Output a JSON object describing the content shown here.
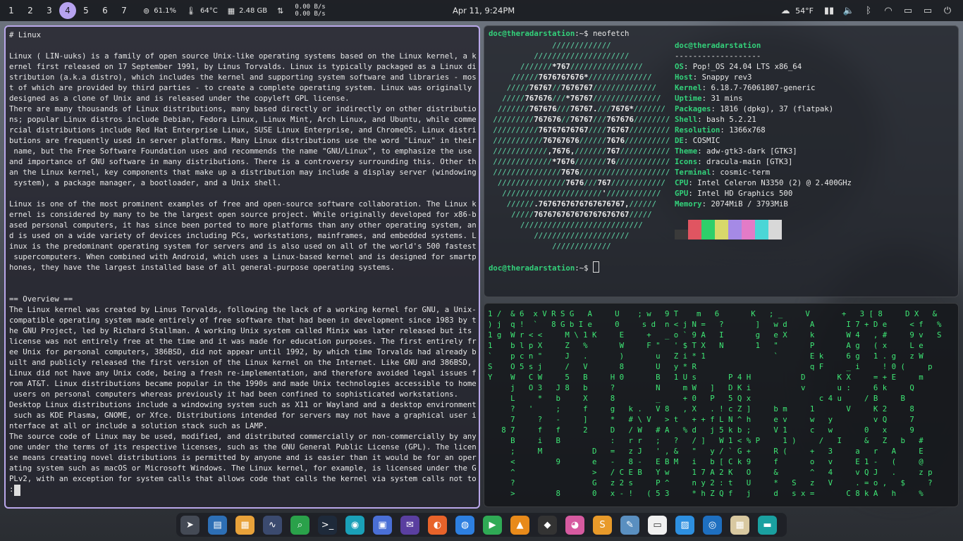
{
  "topbar": {
    "workspaces": [
      "1",
      "2",
      "3",
      "4",
      "5",
      "6",
      "7"
    ],
    "active_workspace": "4",
    "cpu": "61.1%",
    "temp": "64°C",
    "memory": "2.48 GB",
    "net_up": "0.00 B/s",
    "net_down": "0.00 B/s",
    "clock": "Apr 11, 9:24PM",
    "weather": "54°F"
  },
  "left_terminal": {
    "content": "# Linux\n\nLinux ( LIN-uuks) is a family of open source Unix-like operating systems based on the Linux kernel, a k\nernel first released on 17 September 1991, by Linus Torvalds. Linux is typically packaged as a Linux di\nstribution (a.k.a distro), which includes the kernel and supporting system software and libraries - mos\nt of which are provided by third parties - to create a complete operating system. Linux was originally\ndesigned as a clone of Unix and is released under the copyleft GPL license.\nThere are many thousands of Linux distributions, many based directly or indirectly on other distributio\nns; popular Linux distros include Debian, Fedora Linux, Linux Mint, Arch Linux, and Ubuntu, while comme\nrcial distributions include Red Hat Enterprise Linux, SUSE Linux Enterprise, and ChromeOS. Linux distri\nbutions are frequently used in server platforms. Many Linux distributions use the word \"Linux\" in their\n name, but the Free Software Foundation uses and recommends the name \"GNU/Linux\", to emphasize the use\nand importance of GNU software in many distributions. There is a controversy surrounding this. Other th\nan the Linux kernel, key components that make up a distribution may include a display server (windowing\n system), a package manager, a bootloader, and a Unix shell.\n\nLinux is one of the most prominent examples of free and open-source software collaboration. The Linux k\nernel is considered by many to be the largest open source project. While originally developed for x86-b\nased personal computers, it has since been ported to more platforms than any other operating system, an\nd is used on a wide variety of devices including PCs, workstations, mainframes, and embedded systems. L\ninux is the predominant operating system for servers and is also used on all of the world's 500 fastest\n supercomputers. When combined with Android, which uses a Linux-based kernel and is designed for smartp\nhones, they have the largest installed base of all general-purpose operating systems.\n\n\n== Overview ==\nThe Linux kernel was created by Linus Torvalds, following the lack of a working kernel for GNU, a Unix-\ncompatible operating system made entirely of free software that had been in development since 1983 by t\nhe GNU Project, led by Richard Stallman. A working Unix system called Minix was later released but its\nlicense was not entirely free at the time and it was made for education purposes. The first entirely fr\nee Unix for personal computers, 386BSD, did not appear until 1992, by which time Torvalds had already b\nuilt and publicly released the first version of the Linux kernel on the Internet. Like GNU and 386BSD,\nLinux did not have any Unix code, being a fresh re-implementation, and therefore avoided legal issues f\nrom AT&T. Linux distributions became popular in the 1990s and made Unix technologies accessible to home\n users on personal computers whereas previously it had been confined to sophisticated workstations.\nDesktop Linux distributions include a windowing system such as X11 or Wayland and a desktop environment\n such as KDE Plasma, GNOME, or Xfce. Distributions intended for servers may not have a graphical user i\nnterface at all or include a solution stack such as LAMP.\nThe source code of Linux may be used, modified, and distributed commercially or non-commercially by any\none under the terms of its respective licenses, such as the GNU General Public License (GPL). The licen\nse means creating novel distributions is permitted by anyone and is easier than it would be for an oper\nating system such as macOS or Microsoft Windows. The Linux kernel, for example, is licensed under the G\nPLv2, with an exception for system calls that allows code that calls the kernel via system calls not to\n:"
  },
  "neofetch": {
    "prompt_user": "doc@theradarstation",
    "prompt_suffix": ":~$ ",
    "command": "neofetch",
    "logo": [
      "              /////////////",
      "          /////////////////////",
      "       ///////*767////////////////",
      "     //////7676767676*//////////////",
      "    /////76767//7676767//////////////",
      "   /////767676///*76767///////////////",
      "  ///////767676///76767.///7676*///////",
      " /////////767676//76767///767676////////",
      " //////////76767676767////76767/////////",
      " ///////////76767676//////7676//////////",
      " ////////////,7676,///////767///////////",
      " /////////////*7676///////76////////////",
      " ///////////////7676////////////////////",
      "  ///////////////7676///767////////////",
      "   //////////////////////'////////////",
      "    //////.7676767676767676767,//////",
      "     /////767676767676767676767/////",
      "       ///////////////////////////",
      "          /////////////////////",
      "              /////////////"
    ],
    "title": "doc@theradarstation",
    "separator": "-------------------",
    "info": [
      {
        "k": "OS",
        "v": "Pop!_OS 24.04 LTS x86_64"
      },
      {
        "k": "Host",
        "v": "Snappy rev3"
      },
      {
        "k": "Kernel",
        "v": "6.18.7-76061807-generic"
      },
      {
        "k": "Uptime",
        "v": "31 mins"
      },
      {
        "k": "Packages",
        "v": "1816 (dpkg), 37 (flatpak)"
      },
      {
        "k": "Shell",
        "v": "bash 5.2.21"
      },
      {
        "k": "Resolution",
        "v": "1366x768"
      },
      {
        "k": "DE",
        "v": "COSMIC"
      },
      {
        "k": "Theme",
        "v": "adw-gtk3-dark [GTK3]"
      },
      {
        "k": "Icons",
        "v": "dracula-main [GTK3]"
      },
      {
        "k": "Terminal",
        "v": "cosmic-term"
      },
      {
        "k": "CPU",
        "v": "Intel Celeron N3350 (2) @ 2.400GHz"
      },
      {
        "k": "GPU",
        "v": "Intel HD Graphics 500"
      },
      {
        "k": "Memory",
        "v": "2074MiB / 3793MiB"
      }
    ],
    "swatches": [
      "#3a3a3a",
      "#e05561",
      "#2fcf6a",
      "#d8d86a",
      "#a58ae6",
      "#e37bc7",
      "#4ad6d6",
      "#d8d8d8"
    ]
  },
  "matrix": {
    "content": "1 /  & 6  x V R S G   A     U    ; w   9 T    m   6       K   ; _     V       +   3 [ 8     D X   &\n) j  q !  `   8 G b I e     0     s d  n < j N =   ?       ]   w d     A       I 7 + D e     < f   %\n1 g  W r < <     M \\ 1 K     E     +   _ o ` 9 A   I       g   e X     k       W 4   , #     9 v   S\n1    b l p X     Z   %       W     F \"   ' $ T X   N       1   \"       P       A g   ( x     L e\n`    p c n \"     J   .       )       u   Z i * 1               `       E k     6 g   1 . g   z W\nS    O 5 s j     /   V       8       U   y * R                         q F     _ i     ! 0 (     p\nY    W   C W     5   B     H 0       B   1 U s       P 4 H           D       K X     = + E     m\n     j   O 3   J 8   b     ?         N     m W   ]   D K i           v       u :     6 k     Q\n     L     *   b     X     8         _     + 0   P   5 Q x               c 4 u     / B     B\n     ?   '     ;     f     g   k .   V 8   , X   . ! c Z ]     b m     1       V     K 2     8\n     7     ?   -     ]     *   # \\ V   > t   + + f L N ^ h     e v     w   y         v Q     7\n   8 7     f   f     2     D   / W   # A   % d   j 5 k b ;     V 1     c   w       0   x     9\n     B     i   B           :   r r   ;   ?   / ]   W 1 < % P     1 )     /   I     &   Z   b   #\n     ;     M           D   =   z J   ' , &   \"   y / ` G +     R (     +   3     a   r   A     E\n     <         9       e   -   8 -   E B M   i   b [ C k 9     f       o   v     E 1 -   (     @\n     ^                 >   / C E B   Y w     1 7 A 2 K   O     &       ^   4     v Q J   .     z p\n     ?                 G   z 2 s     P ^     n y 2 : t   U     *   S   z   V     . = o ,   $     ?\n     >         8       0   x - !   ( 5 3     * h Z Q f   j     d   s x =       C 8 k A   h     %"
  },
  "dock": {
    "apps": [
      "launcher-icon",
      "workspaces-icon",
      "app-library-icon",
      "system-monitor-icon",
      "search-icon",
      "terminal-icon",
      "screenshot-icon",
      "store-icon",
      "mail-icon",
      "firefox-icon",
      "browser-icon",
      "media-player-icon",
      "vlc-icon",
      "inkscape-icon",
      "image-viewer-icon",
      "sublime-text-icon",
      "text-editor-icon",
      "document-viewer-icon",
      "image-editor-icon",
      "camera-icon",
      "calculator-icon",
      "files-icon"
    ]
  }
}
